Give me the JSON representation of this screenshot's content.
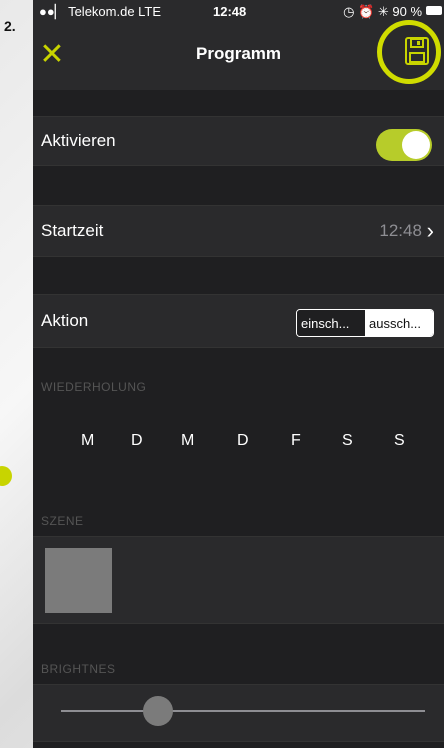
{
  "step_number": "2.",
  "status_bar": {
    "carrier": "●●▏ Telekom.de  LTE",
    "time": "12:48",
    "right": "◷ ⏰ ✳ 90 %"
  },
  "nav": {
    "title": "Programm",
    "close_icon": "✕",
    "save_icon": "save-icon"
  },
  "activate": {
    "label": "Aktivieren",
    "value": true
  },
  "start_time": {
    "label": "Startzeit",
    "value": "12:48",
    "chevron": "›"
  },
  "action": {
    "label": "Aktion",
    "options": [
      "einsch...",
      "aussch..."
    ],
    "selected": "aussch..."
  },
  "repeat": {
    "header": "WIEDERHOLUNG",
    "days": [
      "M",
      "D",
      "M",
      "D",
      "F",
      "S",
      "S"
    ]
  },
  "scene": {
    "header": "SZENE"
  },
  "brightness": {
    "header": "BRIGHTNES",
    "value": 0.27
  },
  "colors": {
    "accent": "#c8d400",
    "toggle": "#b7cc2a",
    "background": "#1f1f21",
    "row": "#2a2a2c"
  }
}
